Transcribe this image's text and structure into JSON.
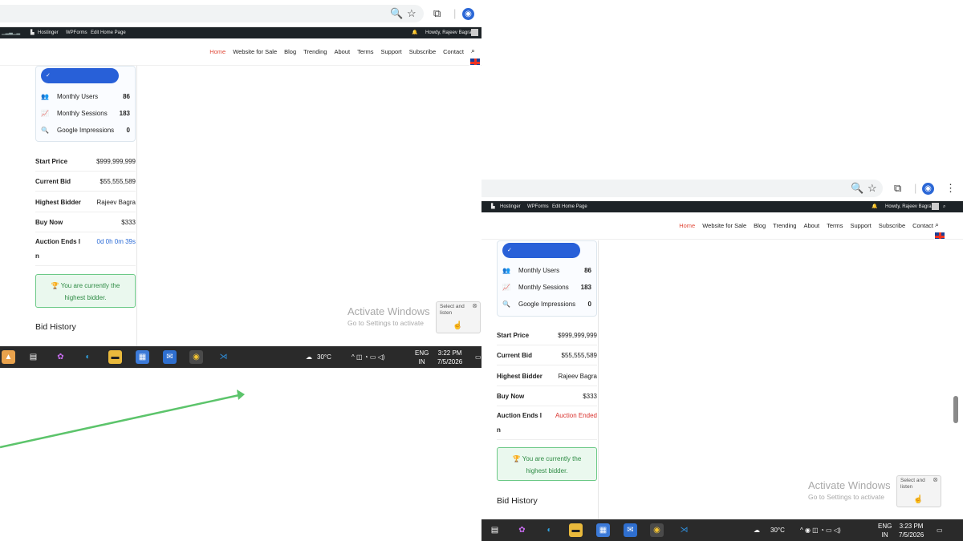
{
  "screens": [
    {
      "wp": {
        "items": [
          "Hostinger",
          "WPForms",
          "Edit Home Page"
        ],
        "howdy": "Howdy, Rajeev Bagra"
      },
      "nav": [
        "Home",
        "Website for Sale",
        "Blog",
        "Trending",
        "About",
        "Terms",
        "Support",
        "Subscribe",
        "Contact"
      ],
      "stats": [
        {
          "label": "Monthly Users",
          "value": "86",
          "icon": "users-icon"
        },
        {
          "label": "Monthly Sessions",
          "value": "183",
          "icon": "chart-icon"
        },
        {
          "label": "Google Impressions",
          "value": "0",
          "icon": "search-icon"
        }
      ],
      "info": [
        {
          "key": "Start Price",
          "value": "$999,999,999"
        },
        {
          "key": "Current Bid",
          "value": "$55,555,589"
        },
        {
          "key": "Highest Bidder",
          "value": "Rajeev Bagra"
        },
        {
          "key": "Buy Now",
          "value": "$333"
        }
      ],
      "ends_key1": "Auction Ends I",
      "ends_key2": "n",
      "ends_value": "0d 0h 0m 39s",
      "bidder_line1": "🏆 You are currently the",
      "bidder_line2": "highest bidder.",
      "bid_history": "Bid History",
      "activate_title": "Activate Windows",
      "activate_sub": "Go to Settings to activate",
      "sal_line1": "Select and",
      "sal_line2": "listen",
      "weather": "30°C",
      "lang1": "ENG",
      "lang2": "IN",
      "time": "3:22 PM",
      "date": "7/5/2026"
    },
    {
      "wp": {
        "items": [
          "Hostinger",
          "WPForms",
          "Edit Home Page"
        ],
        "howdy": "Howdy, Rajeev Bagra"
      },
      "nav": [
        "Home",
        "Website for Sale",
        "Blog",
        "Trending",
        "About",
        "Terms",
        "Support",
        "Subscribe",
        "Contact"
      ],
      "stats": [
        {
          "label": "Monthly Users",
          "value": "86",
          "icon": "users-icon"
        },
        {
          "label": "Monthly Sessions",
          "value": "183",
          "icon": "chart-icon"
        },
        {
          "label": "Google Impressions",
          "value": "0",
          "icon": "search-icon"
        }
      ],
      "info": [
        {
          "key": "Start Price",
          "value": "$999,999,999"
        },
        {
          "key": "Current Bid",
          "value": "$55,555,589"
        },
        {
          "key": "Highest Bidder",
          "value": "Rajeev Bagra"
        },
        {
          "key": "Buy Now",
          "value": "$333"
        }
      ],
      "ends_key1": "Auction Ends I",
      "ends_key2": "n",
      "ends_value": "Auction Ended",
      "bidder_line1": "🏆 You are currently the",
      "bidder_line2": "highest bidder.",
      "bid_history": "Bid History",
      "activate_title": "Activate Windows",
      "activate_sub": "Go to Settings to activate",
      "sal_line1": "Select and",
      "sal_line2": "listen",
      "weather": "30°C",
      "lang1": "ENG",
      "lang2": "IN",
      "time": "3:23 PM",
      "date": "7/5/2026"
    }
  ],
  "colors": {
    "accent_blue": "#2860d8",
    "nav_active": "#e04a3a",
    "ended_red": "#d9302c",
    "success_green": "#2e8b44",
    "arrow_green": "#5cc46b"
  }
}
